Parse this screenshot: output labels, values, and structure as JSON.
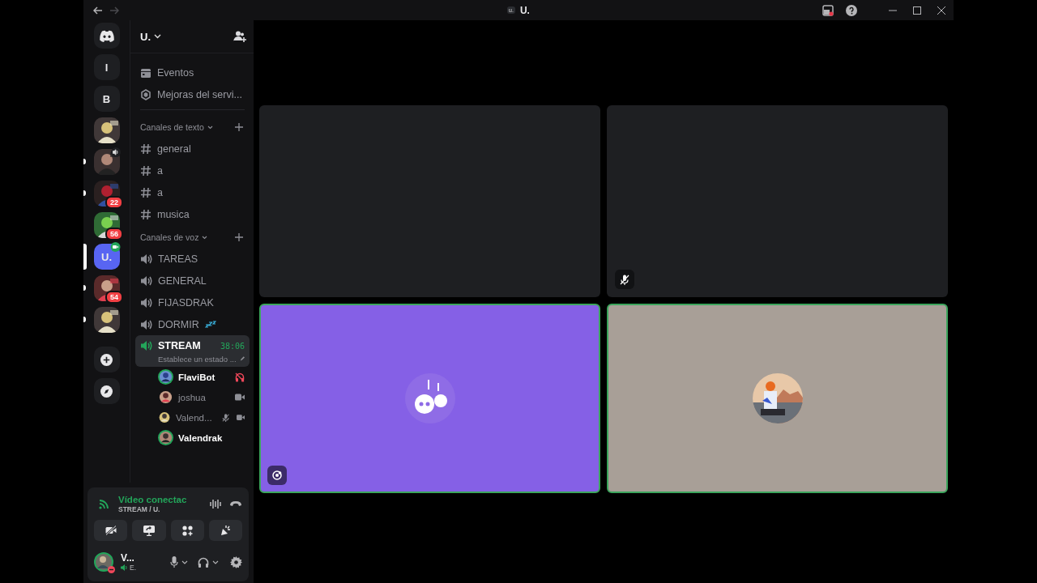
{
  "titlebar": {
    "badge": "u.",
    "title": "U."
  },
  "servers": [
    {
      "kind": "home",
      "selected": false,
      "unread": false,
      "in_voice": false,
      "in_video": false
    },
    {
      "kind": "letter",
      "label": "l",
      "selected": false,
      "unread": false,
      "in_voice": false,
      "in_video": false
    },
    {
      "kind": "letter",
      "label": "B",
      "selected": false,
      "unread": false,
      "in_voice": false,
      "in_video": false
    },
    {
      "kind": "picture",
      "selected": false,
      "unread": false,
      "in_voice": false,
      "in_video": false
    },
    {
      "kind": "picture",
      "selected": false,
      "unread": true,
      "in_voice": true,
      "in_video": false
    },
    {
      "kind": "picture",
      "selected": false,
      "unread": true,
      "in_voice": false,
      "in_video": false,
      "badge": "22"
    },
    {
      "kind": "picture",
      "selected": false,
      "unread": false,
      "in_voice": false,
      "in_video": false,
      "badge": "56"
    },
    {
      "kind": "letter",
      "label": "U.",
      "selected": true,
      "unread": false,
      "in_voice": false,
      "in_video": true
    },
    {
      "kind": "picture",
      "selected": false,
      "unread": true,
      "in_voice": false,
      "in_video": false,
      "badge": "54"
    },
    {
      "kind": "picture",
      "selected": false,
      "unread": true,
      "in_voice": false,
      "in_video": false
    },
    {
      "kind": "add"
    },
    {
      "kind": "explore"
    }
  ],
  "server": {
    "name": "U."
  },
  "shortcuts": [
    {
      "kind": "events",
      "label": "Eventos"
    },
    {
      "kind": "boosts",
      "label": "Mejoras del servi..."
    }
  ],
  "categories": [
    {
      "name": "Canales de texto",
      "kind": "text",
      "channels": [
        {
          "name": "general",
          "selected": false
        },
        {
          "name": "a",
          "selected": false
        },
        {
          "name": "a",
          "selected": false
        },
        {
          "name": "musica",
          "selected": false
        }
      ]
    },
    {
      "name": "Canales de voz",
      "kind": "voice",
      "channels": [
        {
          "name": "TAREAS",
          "selected": false
        },
        {
          "name": "GENERAL",
          "selected": false
        },
        {
          "name": "FIJASDRAK",
          "selected": false
        },
        {
          "name": "DORMIR",
          "selected": false,
          "emoji": true
        },
        {
          "name": "STREAM",
          "selected": true,
          "timer": "38:06",
          "status": "Establece un estado ...",
          "members": [
            {
              "name": "FlaviBot",
              "speaking": true,
              "deafened": true,
              "muted": false,
              "video": false
            },
            {
              "name": "joshua",
              "speaking": false,
              "deafened": false,
              "muted": false,
              "video": true
            },
            {
              "name": "Valend...",
              "speaking": false,
              "deafened": false,
              "muted": true,
              "video": true
            },
            {
              "name": "Valendrak",
              "speaking": true,
              "deafened": false,
              "muted": false,
              "video": false
            }
          ]
        }
      ]
    }
  ],
  "voice_panel": {
    "status": "Vídeo conectac",
    "channel": "STREAM / U."
  },
  "user": {
    "name": "V...",
    "status": "E.",
    "dnd": true
  },
  "tiles": [
    {
      "kind": "empty",
      "muted": false,
      "speaking": false,
      "activity": false
    },
    {
      "kind": "empty",
      "muted": true,
      "speaking": false,
      "activity": false
    },
    {
      "kind": "avatar",
      "color": "#8560e6",
      "speaking": true,
      "muted": false,
      "activity": true
    },
    {
      "kind": "avatar",
      "color": "#a89f97",
      "speaking": true,
      "muted": false,
      "activity": false
    }
  ]
}
